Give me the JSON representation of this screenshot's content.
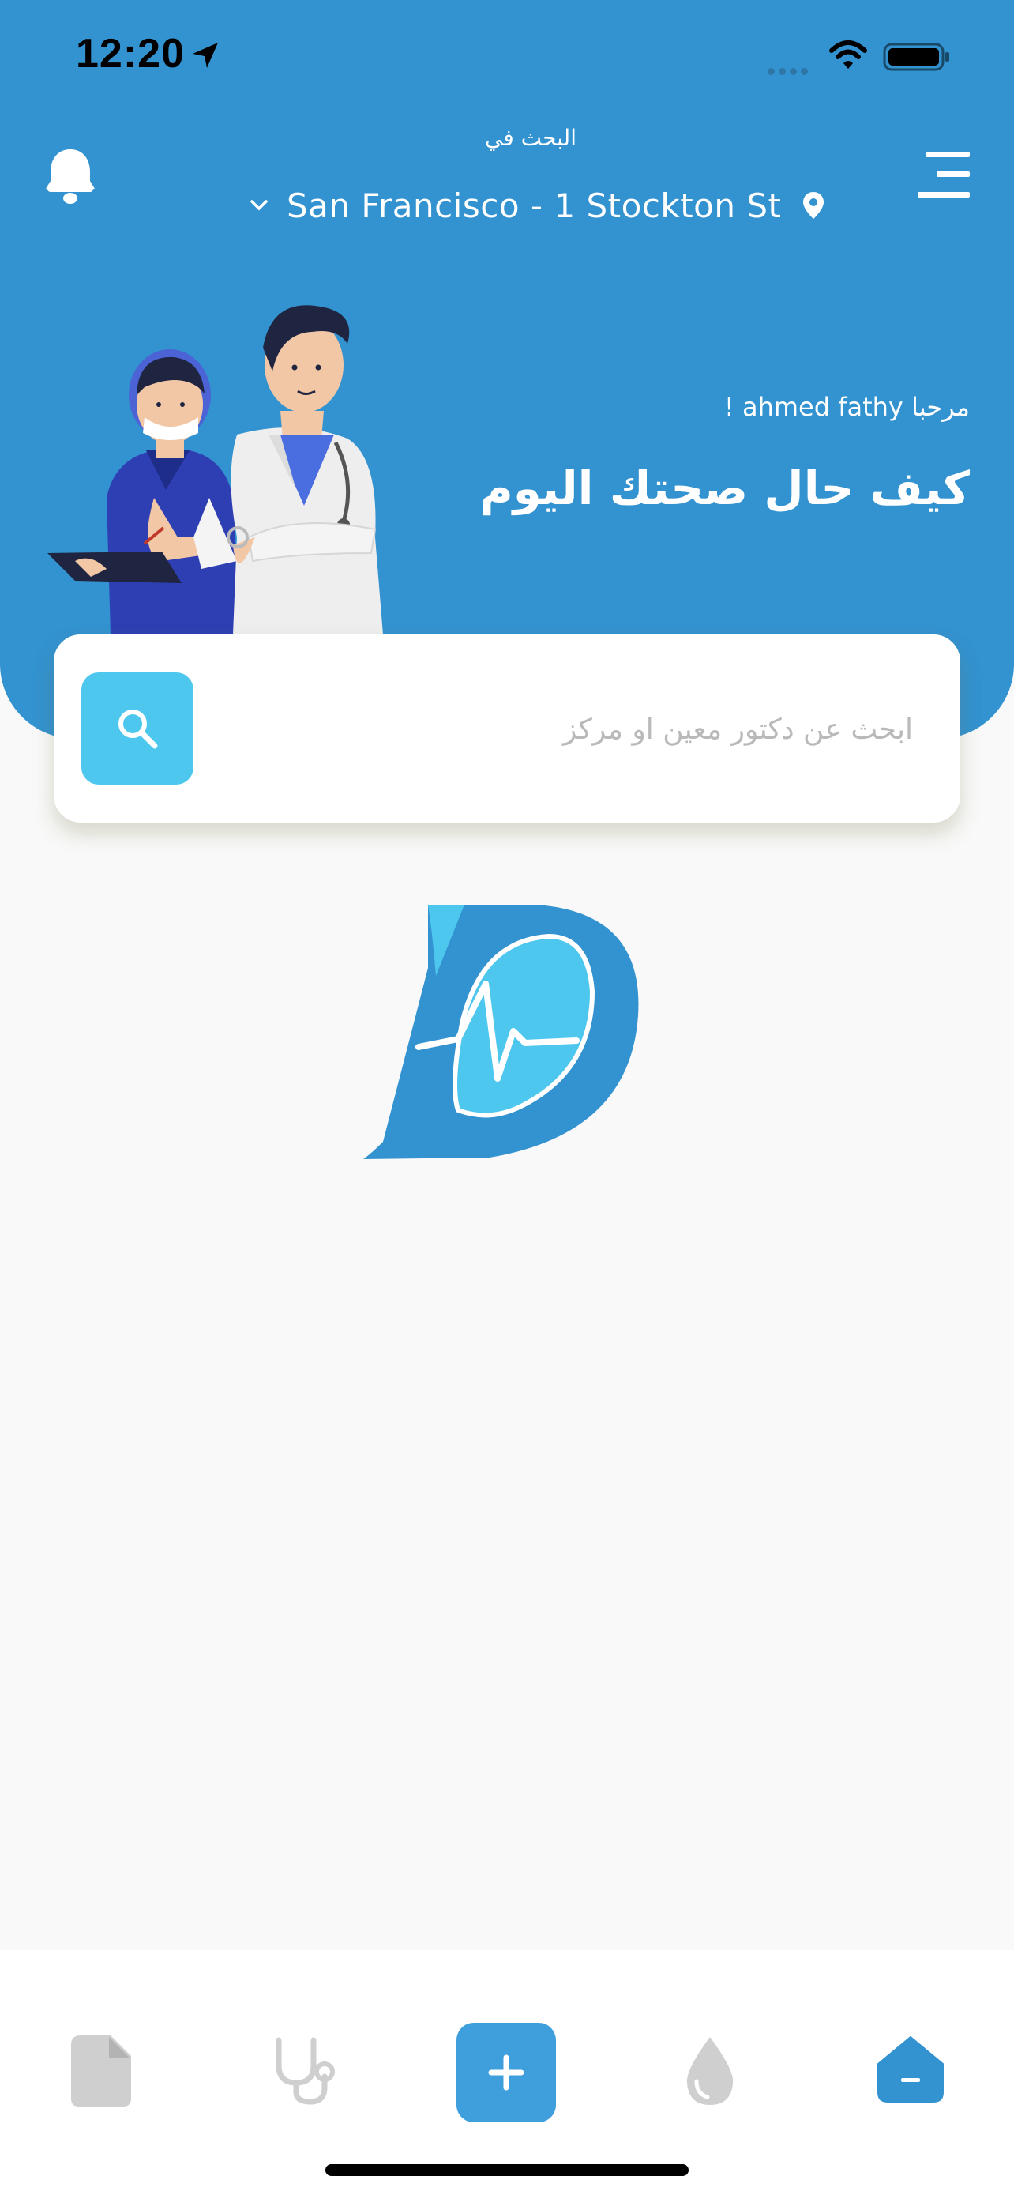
{
  "status_bar": {
    "time": "12:20"
  },
  "header": {
    "search_in_label": "البحث في",
    "location": "San Francisco - 1 Stockton St",
    "greeting": "مرحبا ahmed fathy !",
    "health_question": "كيف حال صحتك اليوم",
    "background_color": "#3392d0"
  },
  "search": {
    "placeholder": "ابحث عن دكتور معين او مركز",
    "button_color": "#4ec7ef"
  },
  "tabbar": {
    "items": [
      {
        "icon": "file-icon",
        "active": false
      },
      {
        "icon": "stethoscope-icon",
        "active": false
      },
      {
        "icon": "add-icon",
        "active": false
      },
      {
        "icon": "blood-drop-icon",
        "active": false
      },
      {
        "icon": "home-icon",
        "active": true
      }
    ],
    "active_color": "#3392d0",
    "inactive_color": "#cfcfcf"
  }
}
